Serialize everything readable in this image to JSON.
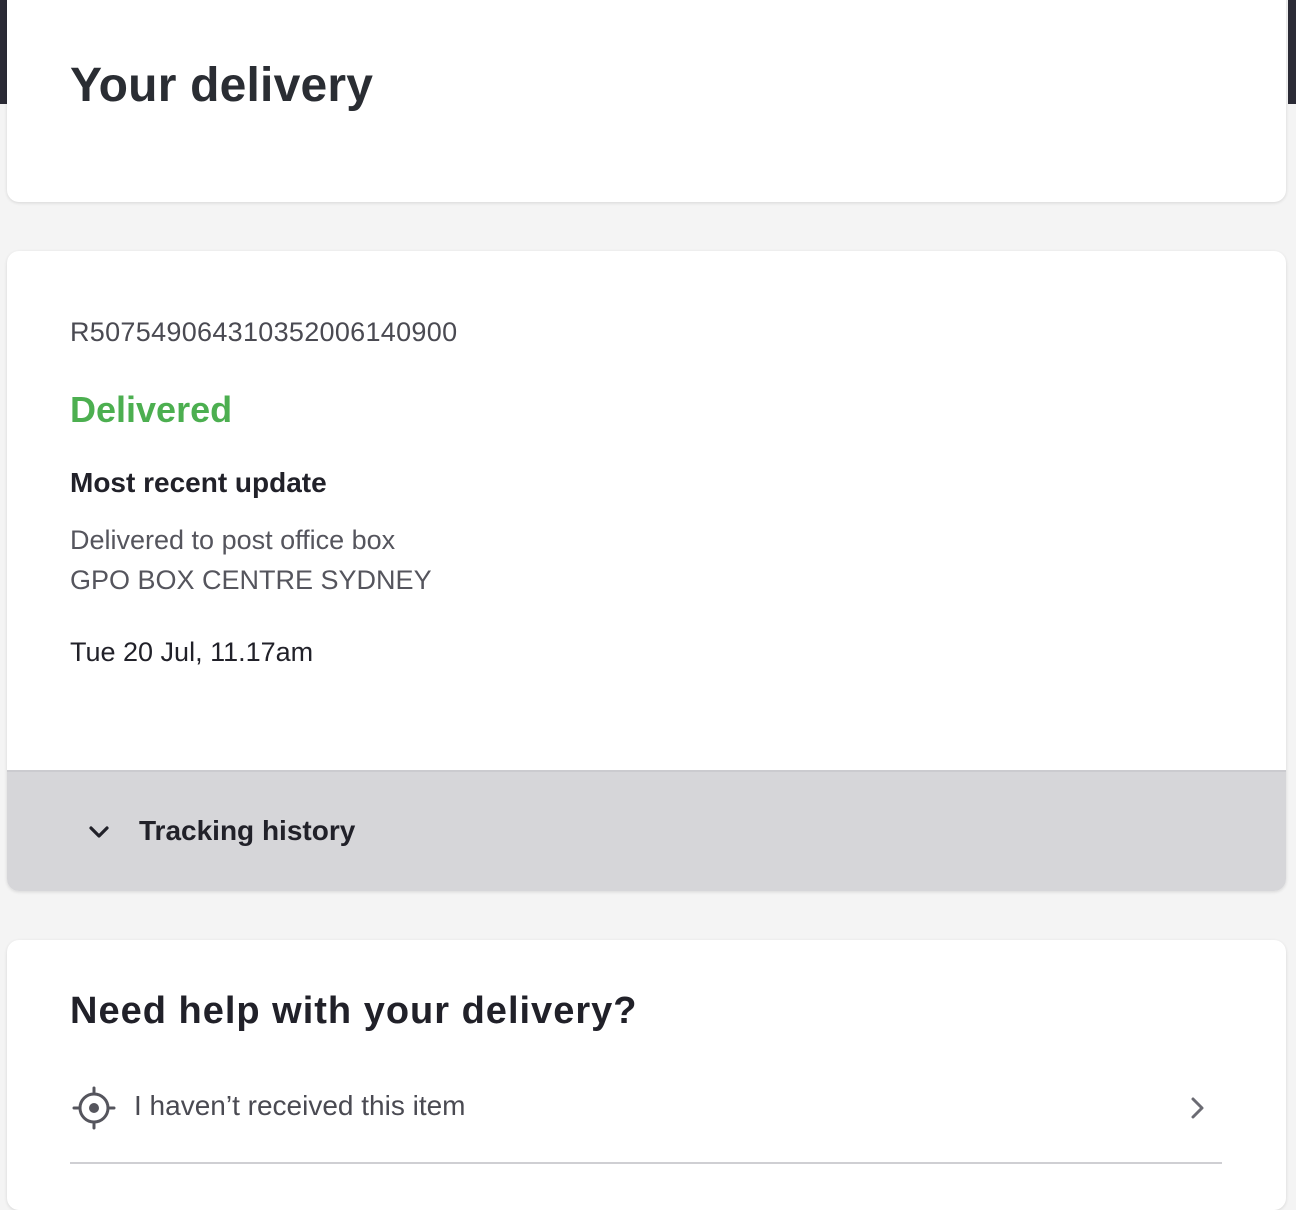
{
  "header": {
    "title": "Your delivery"
  },
  "delivery": {
    "tracking_id": "R5075490643103520061409​00",
    "status": "Delivered",
    "status_color": "#4caf50",
    "update_heading": "Most recent update",
    "update_description": "Delivered to post office box",
    "update_location": "GPO BOX CENTRE SYDNEY",
    "update_time": "Tue 20 Jul, 11.17am",
    "history_toggle": {
      "label": "Tracking history",
      "icon": "chevron-down-icon",
      "expanded": false
    }
  },
  "help": {
    "title": "Need help with your delivery?",
    "items": [
      {
        "label": "I haven’t received this item",
        "icon": "target-icon",
        "arrow": "chevron-right-icon"
      }
    ]
  }
}
